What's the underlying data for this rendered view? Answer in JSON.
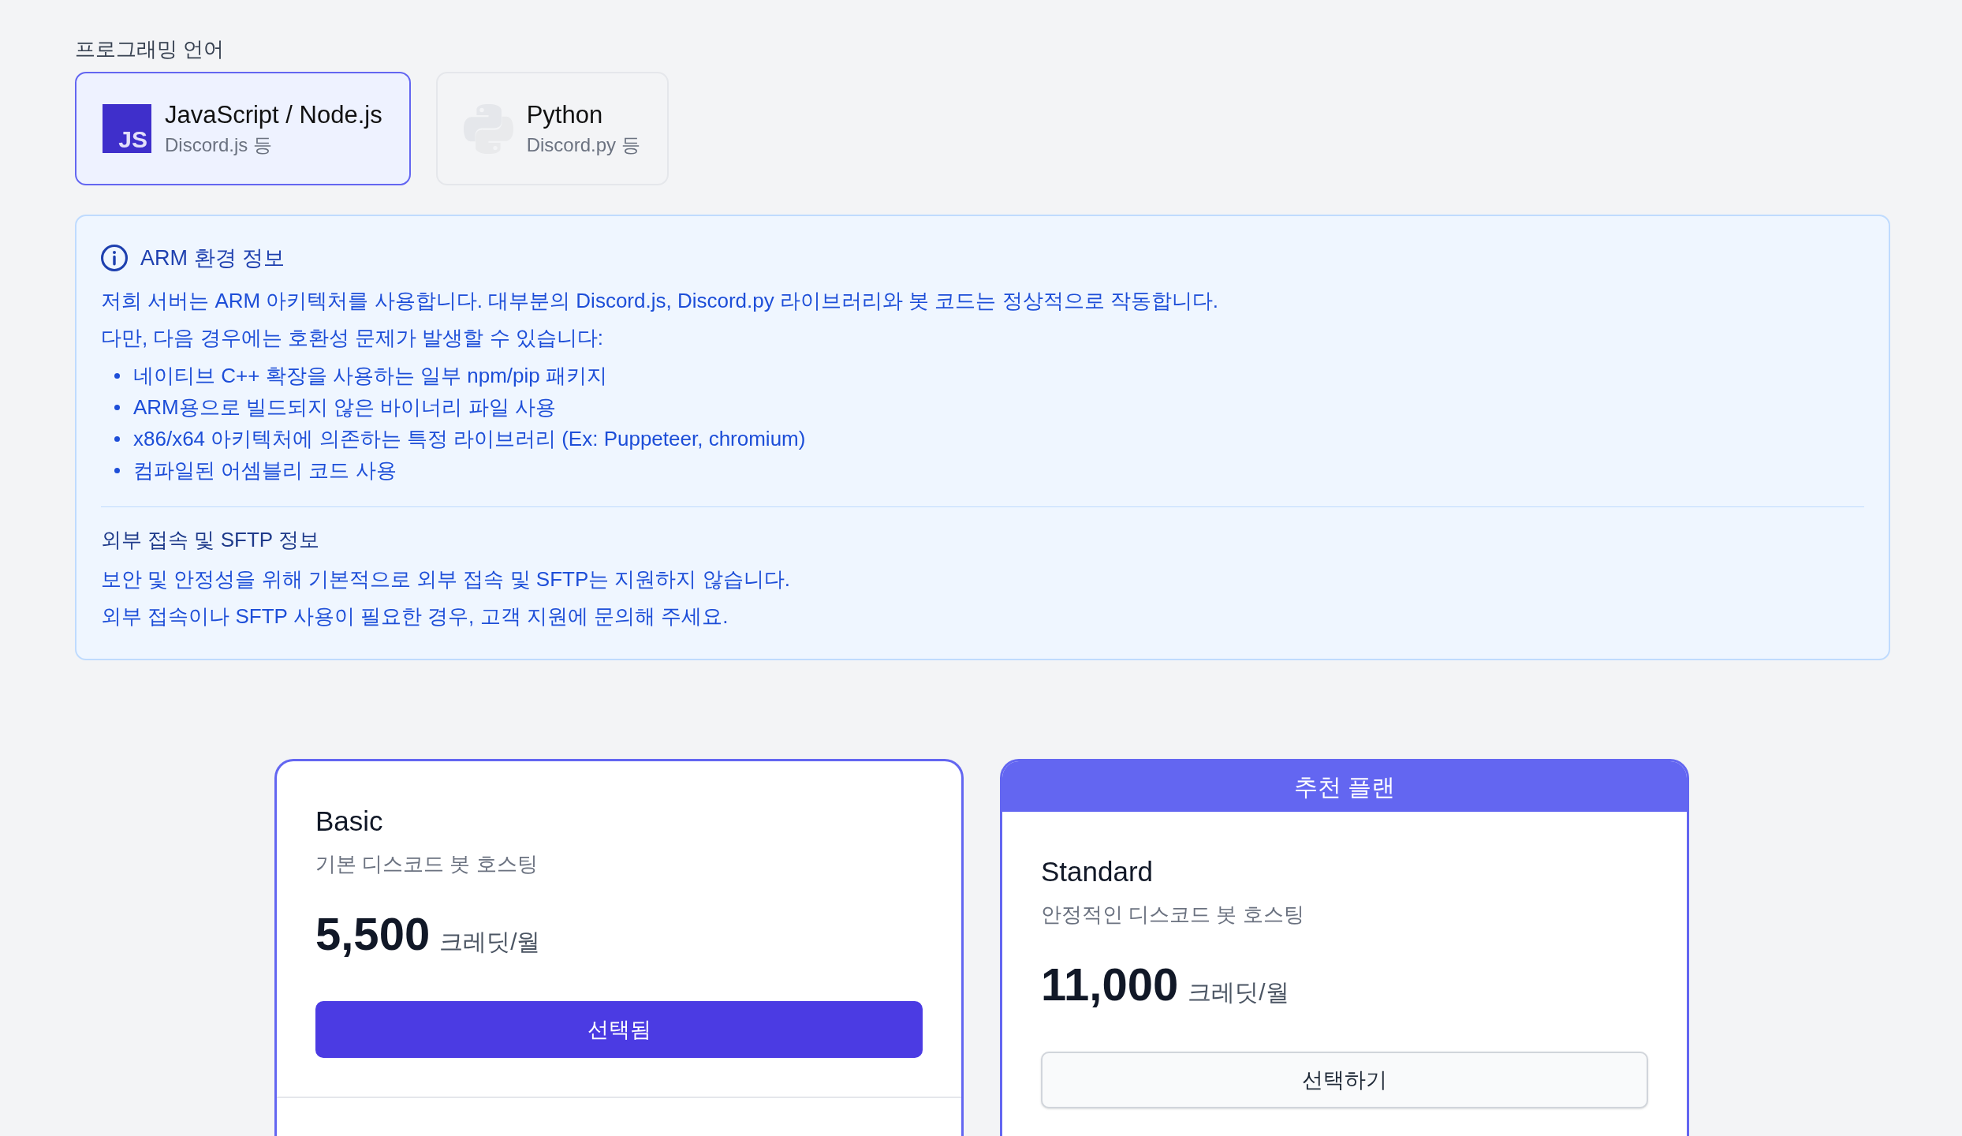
{
  "language_section": {
    "label": "프로그래밍 언어",
    "options": [
      {
        "kind": "javascript",
        "icon_text": "JS",
        "title": "JavaScript / Node.js",
        "subtitle": "Discord.js 등",
        "selected": true
      },
      {
        "kind": "python",
        "title": "Python",
        "subtitle": "Discord.py 등",
        "selected": false
      }
    ]
  },
  "info_box": {
    "title": "ARM 환경 정보",
    "paragraphs": [
      "저희 서버는 ARM 아키텍처를 사용합니다. 대부분의 Discord.js, Discord.py 라이브러리와 봇 코드는 정상적으로 작동합니다.",
      "다만, 다음 경우에는 호환성 문제가 발생할 수 있습니다:"
    ],
    "bullets": [
      "네이티브 C++ 확장을 사용하는 일부 npm/pip 패키지",
      "ARM용으로 빌드되지 않은 바이너리 파일 사용",
      "x86/x64 아키텍처에 의존하는 특정 라이브러리 (Ex: Puppeteer, chromium)",
      "컴파일된 어셈블리 코드 사용"
    ],
    "subsection": {
      "title": "외부 접속 및 SFTP 정보",
      "paragraphs": [
        "보안 및 안정성을 위해 기본적으로 외부 접속 및 SFTP는 지원하지 않습니다.",
        "외부 접속이나 SFTP 사용이 필요한 경우, 고객 지원에 문의해 주세요."
      ]
    }
  },
  "plans": [
    {
      "name": "Basic",
      "description": "기본 디스코드 봇 호스팅",
      "price": "5,500",
      "unit": "크레딧/월",
      "button": "선택됨",
      "selected": true
    },
    {
      "badge": "추천 플랜",
      "name": "Standard",
      "description": "안정적인 디스코드 봇 호스팅",
      "price": "11,000",
      "unit": "크레딧/월",
      "button": "선택하기",
      "selected": false
    }
  ]
}
